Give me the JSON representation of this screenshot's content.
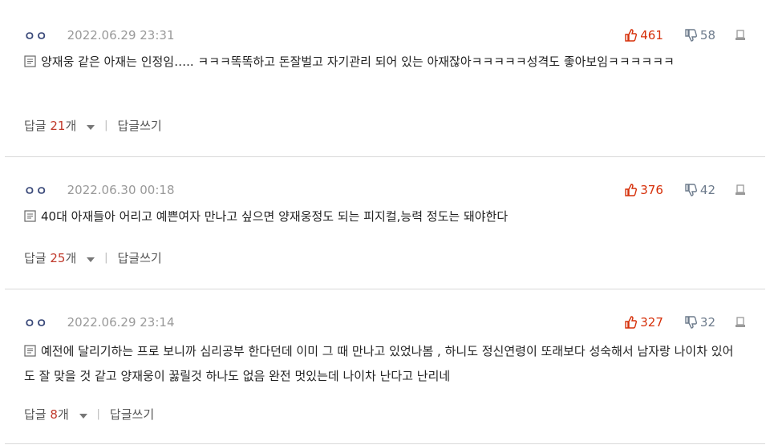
{
  "colors": {
    "up": "#d6300a",
    "down": "#6d7b8c",
    "count": "#c0392b"
  },
  "comments": [
    {
      "user": "ㅇㅇ",
      "date": "2022.06.29 23:31",
      "likes": "461",
      "dislikes": "58",
      "text": "양재웅 같은 아재는 인정임….. ㅋㅋㅋ똑똑하고 돈잘벌고 자기관리 되어 있는 아재잖아ㅋㅋㅋㅋㅋ성격도 좋아보임ㅋㅋㅋㅋㅋㅋ",
      "reply_label": "답글",
      "reply_count": "21",
      "reply_unit": "개",
      "write_reply": "답글쓰기"
    },
    {
      "user": "ㅇㅇ",
      "date": "2022.06.30 00:18",
      "likes": "376",
      "dislikes": "42",
      "text": "40대 아재들아 어리고 예쁜여자 만나고 싶으면 양재웅정도 되는 피지컬,능력 정도는 돼야한다",
      "reply_label": "답글",
      "reply_count": "25",
      "reply_unit": "개",
      "write_reply": "답글쓰기"
    },
    {
      "user": "ㅇㅇ",
      "date": "2022.06.29 23:14",
      "likes": "327",
      "dislikes": "32",
      "text": "예전에 달리기하는 프로 보니까 심리공부 한다던데 이미 그 때 만나고 있었나봄 , 하니도 정신연령이 또래보다 성숙해서 남자랑 나이차 있어도 잘 맞을 것 같고 양재웅이 꿇릴것 하나도 없음 완전 멋있는데 나이차 난다고 난리네",
      "reply_label": "답글",
      "reply_count": "8",
      "reply_unit": "개",
      "write_reply": "답글쓰기"
    }
  ]
}
